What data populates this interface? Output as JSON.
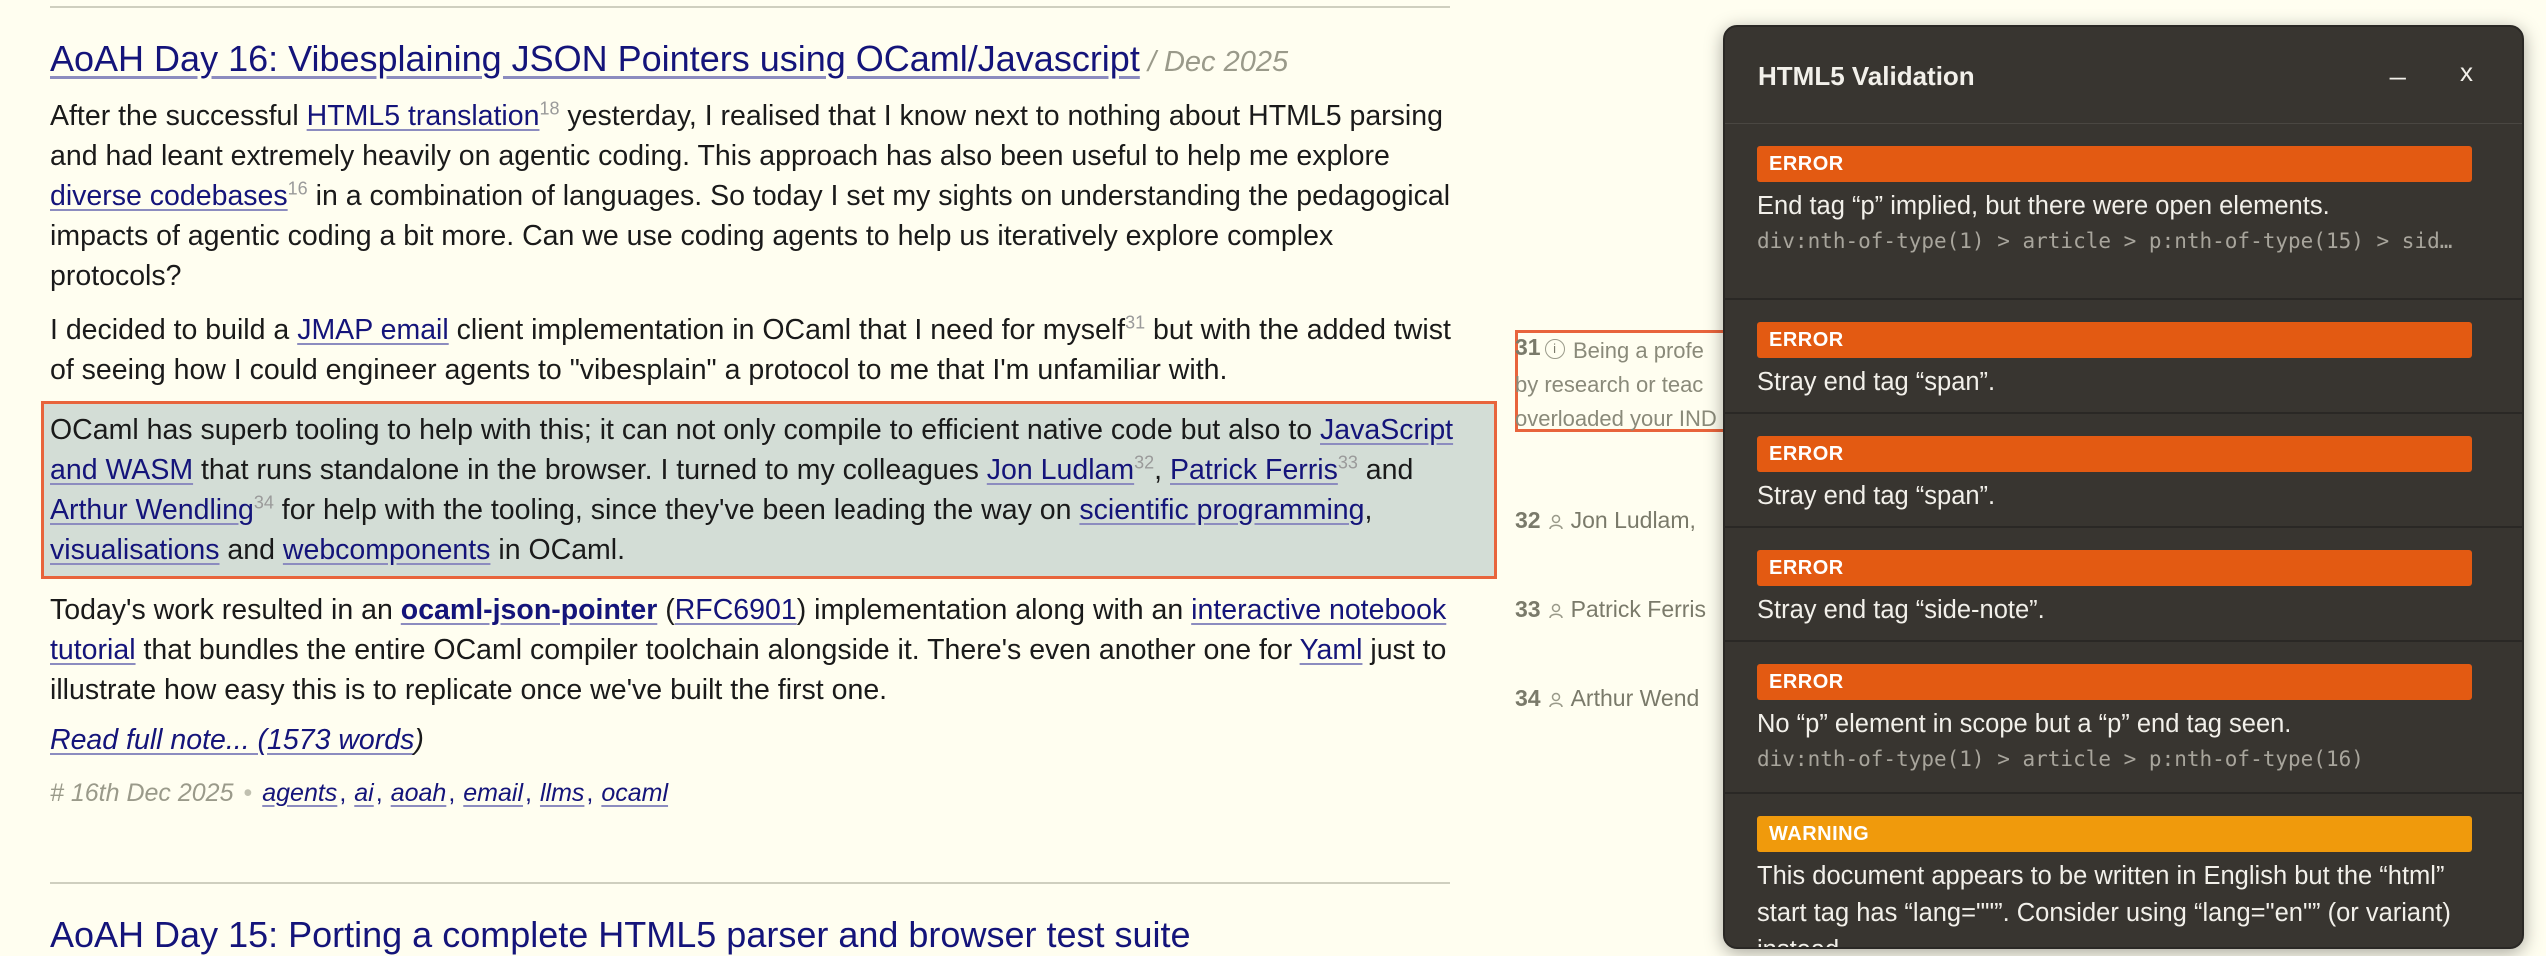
{
  "article": {
    "title": "AoAH Day 16: Vibesplaining JSON Pointers using OCaml/Javascript",
    "date": "/ Dec 2025",
    "p1": {
      "t1": "After the successful ",
      "link1": "HTML5 translation",
      "sup1": "18",
      "t2": " yesterday, I realised that I know next to nothing about HTML5 parsing and had leant extremely heavily on agentic coding. This approach has also been useful to help me explore ",
      "link2": "diverse codebases",
      "sup2": "16",
      "t3": " in a combination of languages. So today I set my sights on understanding the pedagogical impacts of agentic coding a bit more. Can we use coding agents to help us iteratively explore complex protocols?"
    },
    "p2": {
      "t1": "I decided to build a ",
      "link1": "JMAP email",
      "t2": " client implementation in OCaml that I need for myself",
      "sup1": "31",
      "t3": " but with the added twist of seeing how I could engineer agents to \"vibesplain\" a protocol to me that I'm unfamiliar with."
    },
    "p3": {
      "t1": "OCaml has superb tooling to help with this; it can not only compile to efficient native code but also to ",
      "link1": "JavaScript and WASM",
      "t2": " that runs standalone in the browser. I turned to my colleagues ",
      "link2": "Jon Ludlam",
      "sup2": "32",
      "t3": ", ",
      "link3": "Patrick Ferris",
      "sup3": "33",
      "t4": " and ",
      "link4": "Arthur Wendling",
      "sup4": "34",
      "t5": " for help with the tooling, since they've been leading the way on ",
      "link5": "scientific programming",
      "t6": ", ",
      "link6": "visualisations",
      "t7": " and ",
      "link7": "webcomponents",
      "t8": " in OCaml."
    },
    "p4": {
      "t1": "Today's work resulted in an ",
      "link1": "ocaml-json-pointer",
      "t2": " (",
      "link2": "RFC6901",
      "t3": ") implementation along with an ",
      "link3": "interactive notebook tutorial",
      "t4": " that bundles the entire OCaml compiler toolchain alongside it. There's even another one for ",
      "link4": "Yaml",
      "t5": " just to illustrate how easy this is to replicate once we've built the first one."
    },
    "read_more_link": "Read full note... (1573 words",
    "read_more_suffix": ")",
    "meta": {
      "date": "# 16th Dec 2025",
      "dot": "•",
      "tags": [
        "agents",
        "ai",
        "aoah",
        "email",
        "llms",
        "ocaml"
      ]
    },
    "next_title": "AoAH Day 15: Porting a complete HTML5 parser and browser test suite"
  },
  "sidenotes": {
    "n31": {
      "num": "31",
      "line1": "Being a profe",
      "line2": "by research or teac",
      "line3": "overloaded your IND"
    },
    "n32": {
      "num": "32",
      "name": "Jon Ludlam,"
    },
    "n33": {
      "num": "33",
      "name": "Patrick Ferris"
    },
    "n34": {
      "num": "34",
      "name": "Arthur Wend"
    }
  },
  "validation_panel": {
    "title": "HTML5 Validation",
    "minimize": "_",
    "close": "x",
    "messages": [
      {
        "level": "ERROR",
        "text": "End tag “p” implied, but there were open elements.",
        "path": "div:nth-of-type(1) > article > p:nth-of-type(15) > sid…"
      },
      {
        "level": "ERROR",
        "text": "Stray end tag “span”."
      },
      {
        "level": "ERROR",
        "text": "Stray end tag “span”."
      },
      {
        "level": "ERROR",
        "text": "Stray end tag “side-note”."
      },
      {
        "level": "ERROR",
        "text": "No “p” element in scope but a “p” end tag seen.",
        "path": "div:nth-of-type(1) > article > p:nth-of-type(16)"
      },
      {
        "level": "WARNING",
        "text": "This document appears to be written in English but the “html” start tag has “lang=\"\"”. Consider using “lang=\"en\"” (or variant) instead."
      }
    ]
  },
  "colors": {
    "background": "#fffef0",
    "link": "#14147a",
    "highlight_border": "#e8643c",
    "error": "#e35a12",
    "warning": "#f09a0c",
    "panel": "#383530"
  }
}
